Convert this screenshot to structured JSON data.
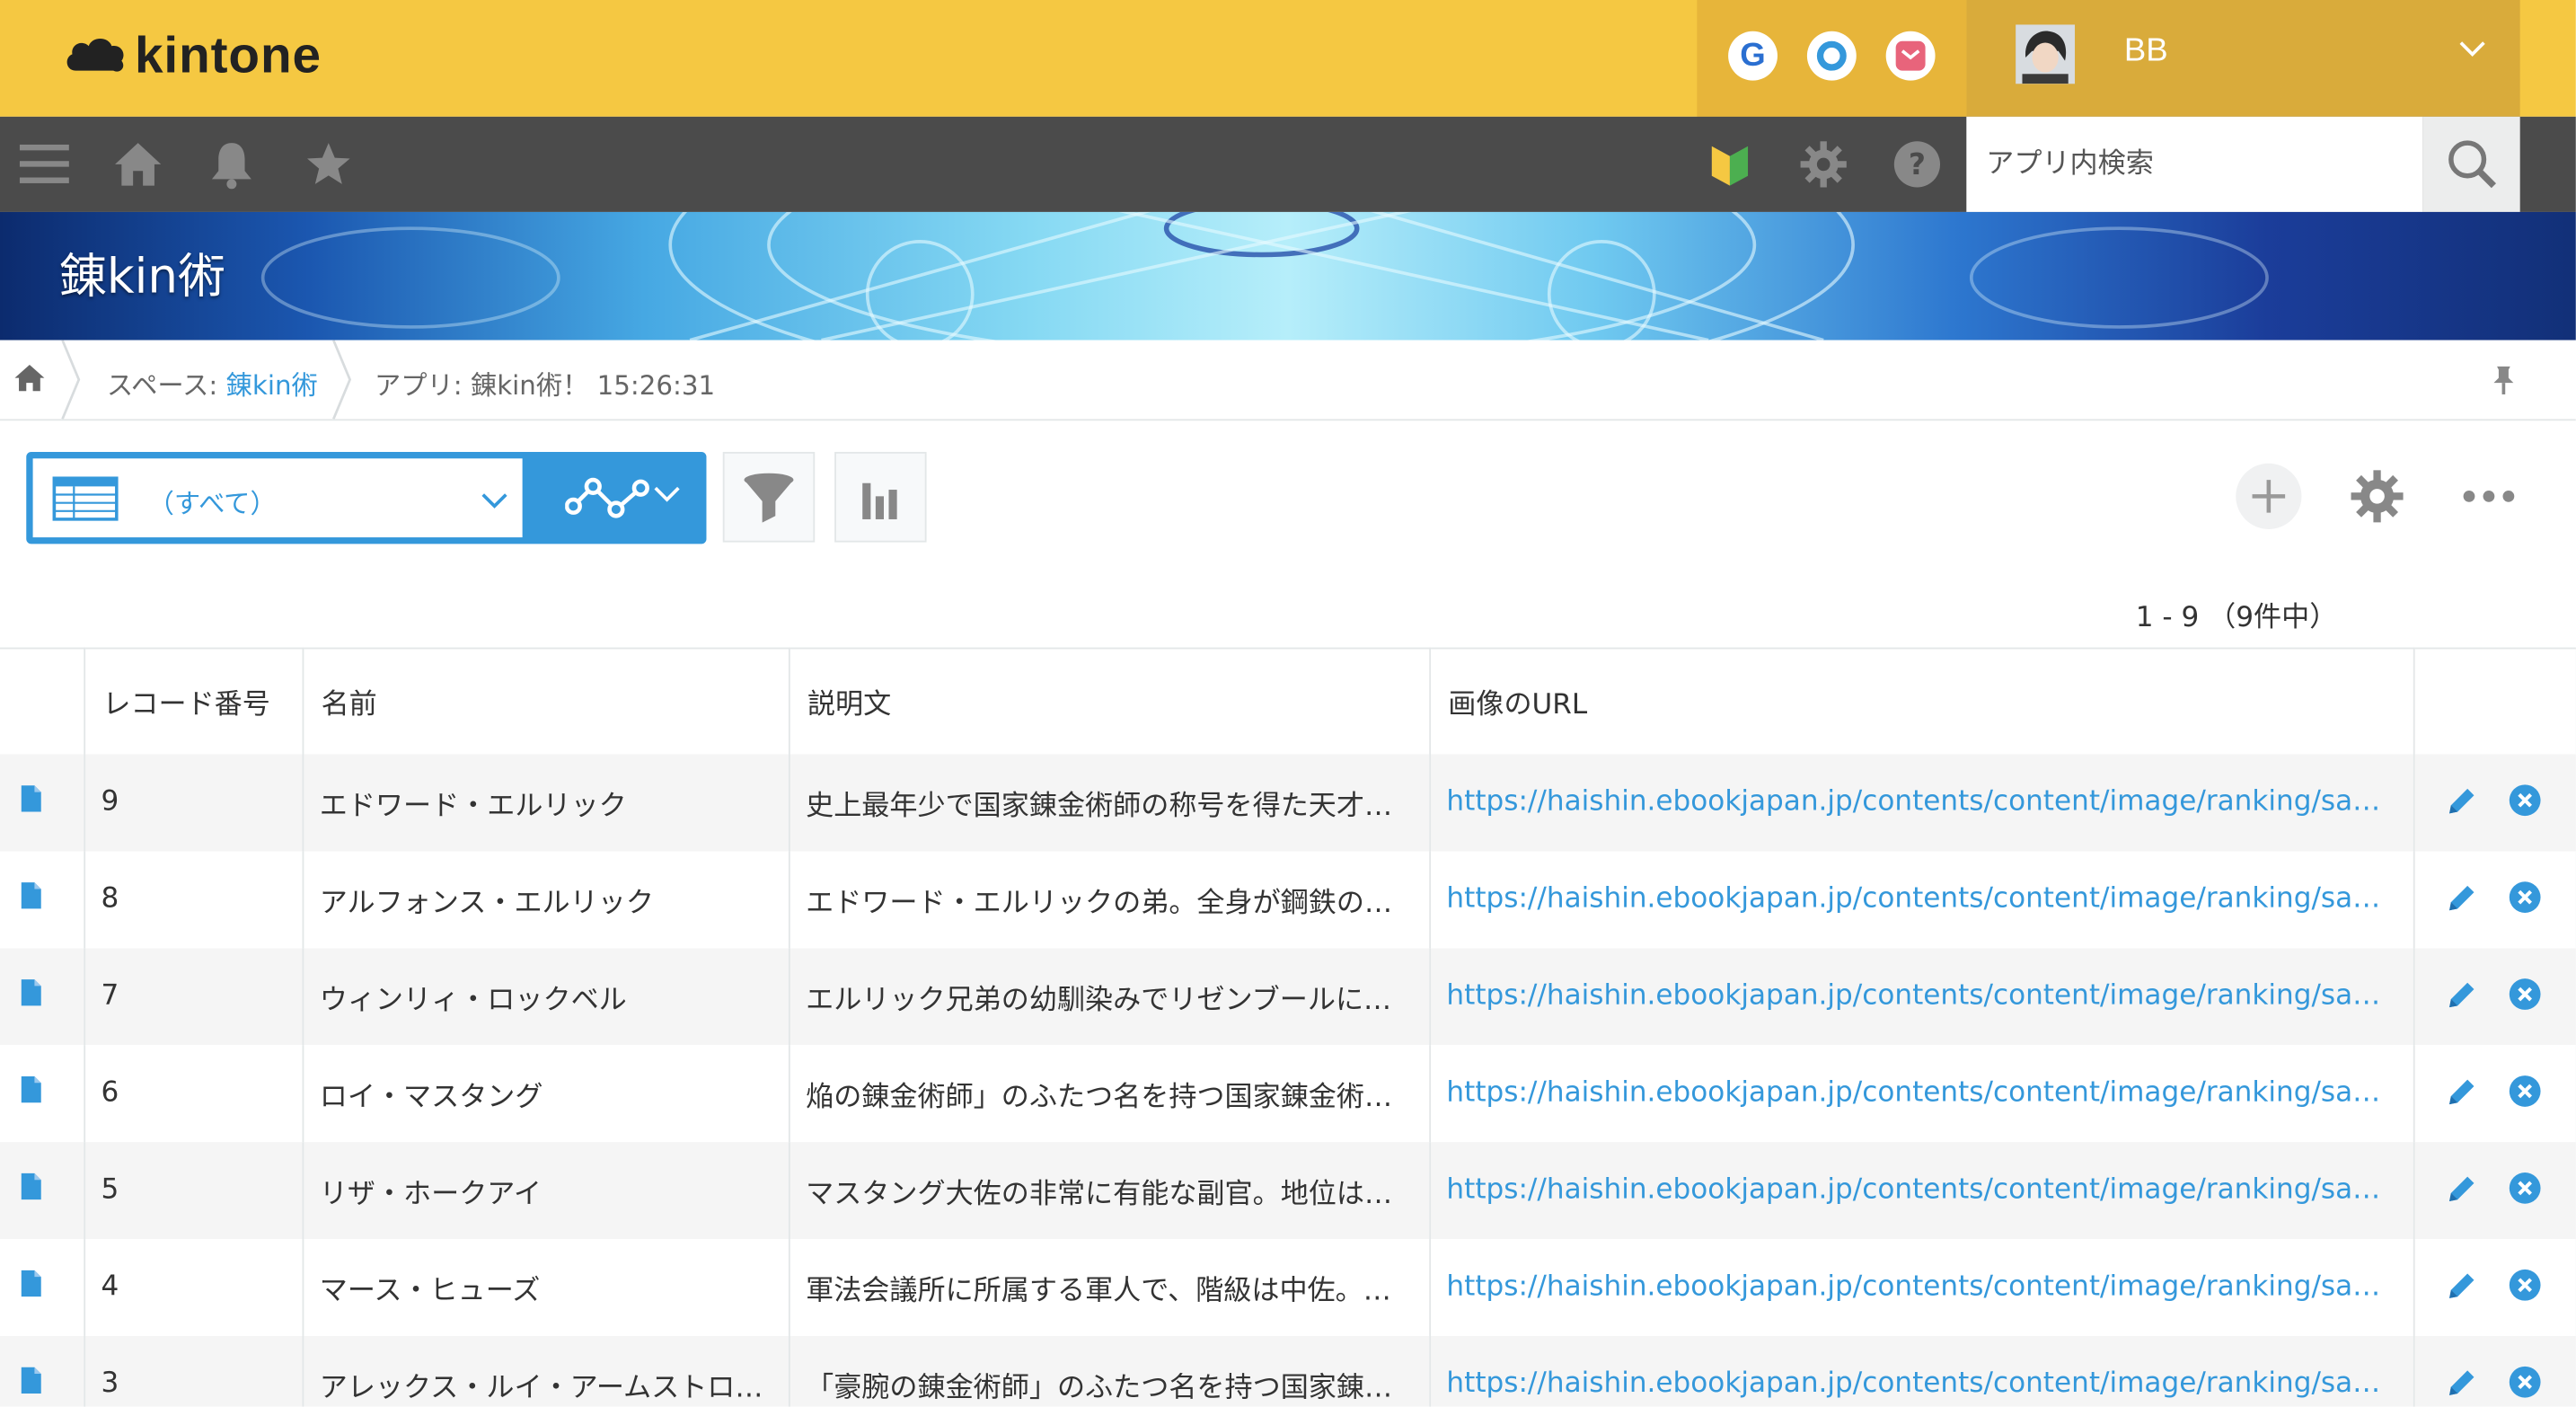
{
  "header": {
    "logo_text": "kintone",
    "user_name": "BB"
  },
  "search": {
    "placeholder": "アプリ内検索"
  },
  "banner": {
    "title": "錬kin術"
  },
  "breadcrumb": {
    "space_prefix": "スペース: ",
    "space_name": "錬kin術",
    "app_text": "アプリ: 錬kin術！ 15:26:31"
  },
  "view": {
    "label": "（すべて）"
  },
  "pager": {
    "text": "1 - 9 （9件中）"
  },
  "table": {
    "columns": [
      "レコード番号",
      "名前",
      "説明文",
      "画像のURL"
    ],
    "rows": [
      {
        "no": "9",
        "name": "エドワード・エルリック",
        "desc": "史上最年少で国家錬金術師の称号を得た天才…",
        "url": "https://haishin.ebookjapan.jp/contents/content/image/ranking/sa…"
      },
      {
        "no": "8",
        "name": "アルフォンス・エルリック",
        "desc": "エドワード・エルリックの弟。全身が鋼鉄の…",
        "url": "https://haishin.ebookjapan.jp/contents/content/image/ranking/sa…"
      },
      {
        "no": "7",
        "name": "ウィンリィ・ロックベル",
        "desc": "エルリック兄弟の幼馴染みでリゼンブールに…",
        "url": "https://haishin.ebookjapan.jp/contents/content/image/ranking/sa…"
      },
      {
        "no": "6",
        "name": "ロイ・マスタング",
        "desc": "焔の錬金術師」のふたつ名を持つ国家錬金術…",
        "url": "https://haishin.ebookjapan.jp/contents/content/image/ranking/sa…"
      },
      {
        "no": "5",
        "name": "リザ・ホークアイ",
        "desc": "マスタング大佐の非常に有能な副官。地位は…",
        "url": "https://haishin.ebookjapan.jp/contents/content/image/ranking/sa…"
      },
      {
        "no": "4",
        "name": "マース・ヒューズ",
        "desc": "軍法会議所に所属する軍人で、階級は中佐。…",
        "url": "https://haishin.ebookjapan.jp/contents/content/image/ranking/sa…"
      },
      {
        "no": "3",
        "name": "アレックス・ルイ・アームストロ…",
        "desc": "「豪腕の錬金術師」のふたつ名を持つ国家錬…",
        "url": "https://haishin.ebookjapan.jp/contents/content/image/ranking/sa…"
      }
    ]
  }
}
